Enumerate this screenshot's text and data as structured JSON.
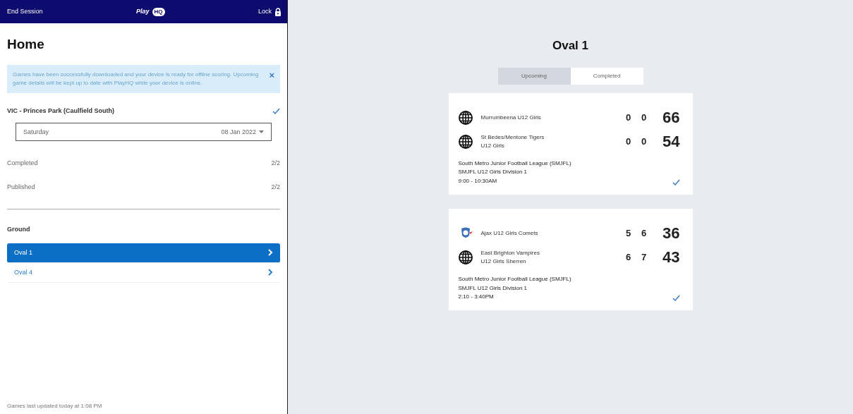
{
  "header": {
    "left": "End Session",
    "logo": {
      "word": "Play",
      "badge": "HQ"
    },
    "right": "Lock"
  },
  "title": "Home",
  "alert": {
    "text": "Games have been successfully downloaded and your device is ready for offline scoring. Upcoming game details will be kept up to date with PlayHQ while your device is online.",
    "close": "×"
  },
  "venue": {
    "name": "VIC - Princes Park (Caulfield South)",
    "checked": true
  },
  "date_select": {
    "day": "Saturday",
    "date": "08 Jan 2022"
  },
  "stats": [
    {
      "label": "Completed",
      "value": "2/2"
    },
    {
      "label": "Published",
      "value": "2/2"
    }
  ],
  "ground": {
    "heading": "Ground",
    "items": [
      {
        "label": "Oval 1",
        "selected": true
      },
      {
        "label": "Oval 4",
        "selected": false
      }
    ]
  },
  "footer": "Games last updated today at 1:08 PM",
  "main": {
    "title": "Oval 1",
    "tabs": [
      {
        "label": "Upcoming",
        "selected": false
      },
      {
        "label": "Completed",
        "selected": true
      }
    ],
    "games": [
      {
        "teams": [
          {
            "name": "Murrumbeena U12 Girls",
            "kind": "globe",
            "goals": "0",
            "behinds": "0",
            "total": "66"
          },
          {
            "name": "St Bedes/Mentone Tigers",
            "sub": "U12 Girls",
            "kind": "globe",
            "goals": "0",
            "behinds": "0",
            "total": "54"
          }
        ],
        "league": "South Metro Junior Football League (SMJFL)",
        "division": "SMJFL U12 Girls Division 1",
        "time": "9:00 - 10:30AM",
        "checked": true
      },
      {
        "teams": [
          {
            "name": "Ajax U12 Girls Comets",
            "kind": "crest",
            "goals": "5",
            "behinds": "6",
            "total": "36"
          },
          {
            "name": "East Brighton Vampires",
            "sub": "U12 Girls Sherren",
            "kind": "globe",
            "goals": "6",
            "behinds": "7",
            "total": "43"
          }
        ],
        "league": "South Metro Junior Football League (SMJFL)",
        "division": "SMJFL U12 Girls Division 1",
        "time": "2:10 - 3:40PM",
        "checked": true
      }
    ]
  }
}
